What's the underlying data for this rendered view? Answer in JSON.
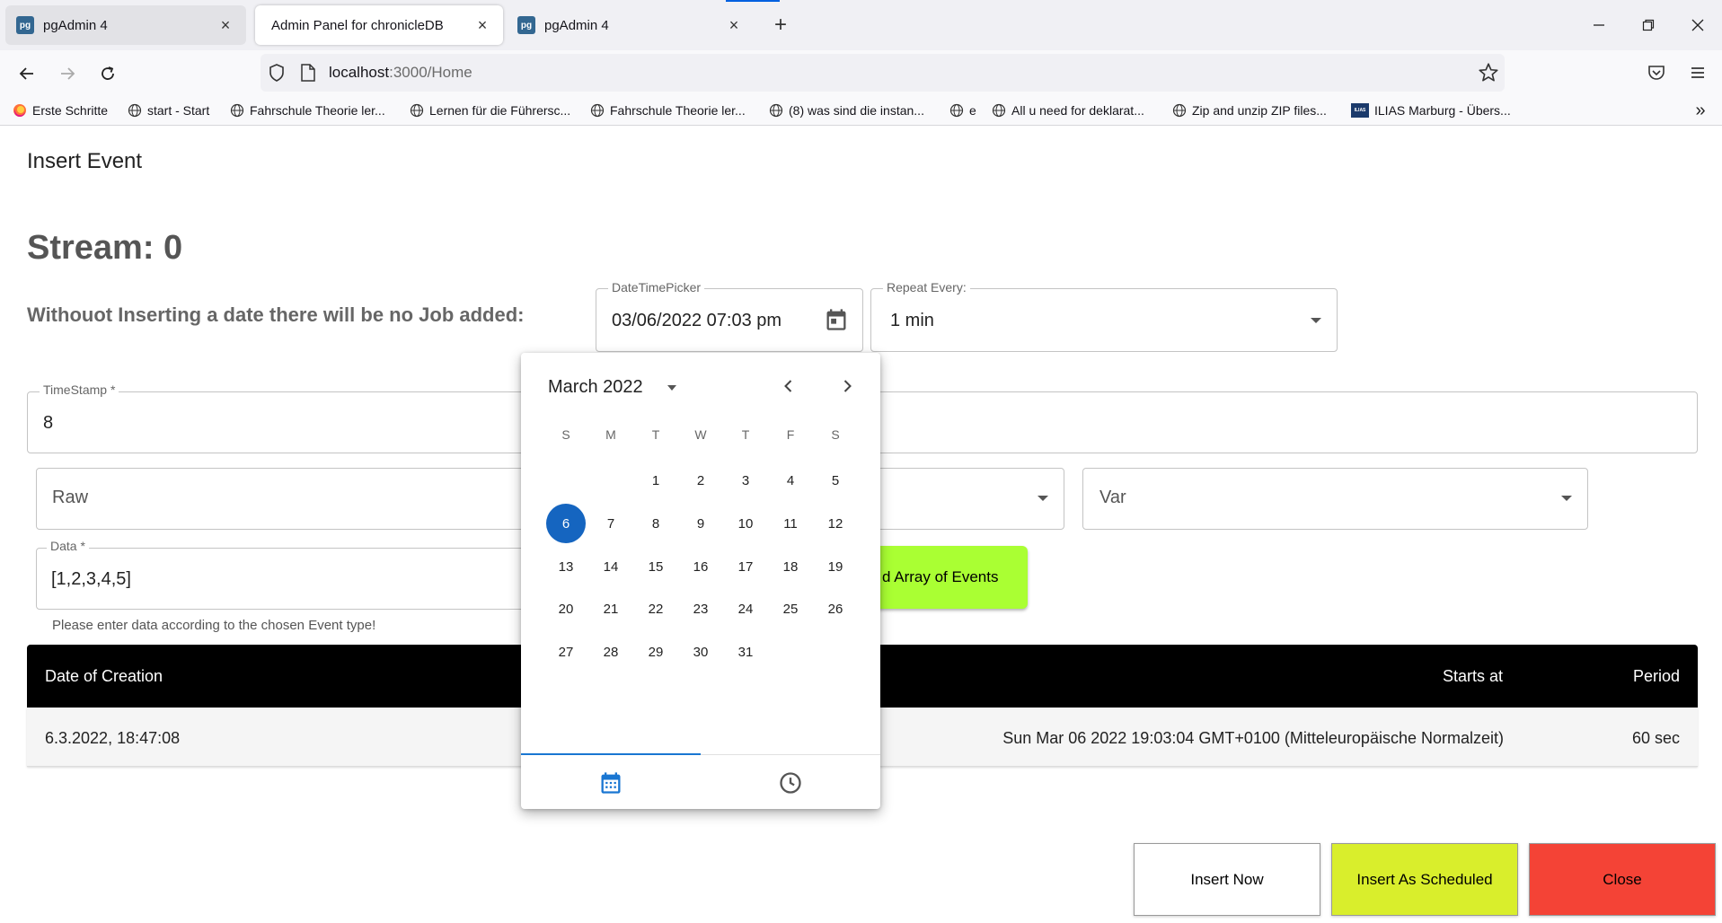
{
  "browser": {
    "tabs": [
      {
        "label": "pgAdmin 4",
        "favicon": "pg",
        "active": false
      },
      {
        "label": "Admin Panel for chronicleDB",
        "active": true
      },
      {
        "label": "pgAdmin 4",
        "favicon": "pg",
        "active": false
      }
    ],
    "close_glyph": "×",
    "new_tab_glyph": "+",
    "url_host": "localhost",
    "url_path": ":3000/Home",
    "bookmarks": [
      "Erste Schritte",
      "start - Start",
      "Fahrschule Theorie ler...",
      "Lernen für die Führersc...",
      "Fahrschule Theorie ler...",
      "(8) was sind die instan...",
      "e",
      "All u need for deklarat...",
      "Zip and unzip ZIP files...",
      "ILIAS Marburg - Übers..."
    ],
    "ilias_favicon": "ILIAS",
    "more_glyph": "»"
  },
  "dialog": {
    "title": "Insert Event",
    "stream_title": "Stream: 0",
    "notice": "Withouot Inserting a date there will be no Job added:",
    "datetime": {
      "label": "DateTimePicker",
      "value": "03/06/2022 07:03 pm"
    },
    "repeat": {
      "label": "Repeat Every:",
      "value": "1 min"
    },
    "timestamp": {
      "label": "TimeStamp *",
      "value": "8"
    },
    "event_type": {
      "value": "Raw"
    },
    "aggregate": {
      "value": "Var"
    },
    "data": {
      "label": "Data *",
      "value": "[1,2,3,4,5]",
      "helper": "Please enter data according to the chosen Event type!"
    },
    "add_array_label": "d Array of Events"
  },
  "table": {
    "headers": {
      "created": "Date of Creation",
      "starts": "Starts at",
      "period": "Period"
    },
    "rows": [
      {
        "created": "6.3.2022, 18:47:08",
        "starts": "Sun Mar 06 2022 19:03:04 GMT+0100 (Mitteleuropäische Normalzeit)",
        "period": "60 sec"
      }
    ]
  },
  "actions": {
    "insert_now": "Insert Now",
    "insert_scheduled": "Insert As Scheduled",
    "close": "Close"
  },
  "picker": {
    "month_label": "March 2022",
    "weekdays": [
      "S",
      "M",
      "T",
      "W",
      "T",
      "F",
      "S"
    ],
    "first_weekday_index": 2,
    "days_in_month": 31,
    "selected_day": 6
  },
  "colors": {
    "accent_blue": "#1565c0",
    "add_array_green": "#aaff33",
    "insert_scheduled_yellow": "#d9ee2c",
    "close_red": "#f44336",
    "table_header": "#000000"
  }
}
